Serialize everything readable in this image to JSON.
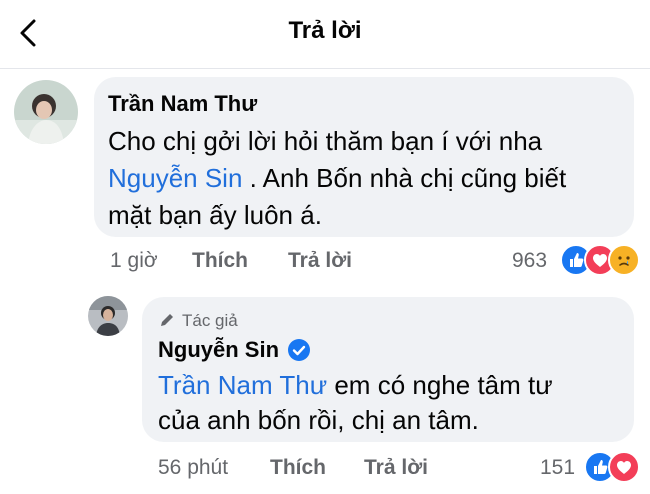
{
  "header": {
    "title": "Trả lời"
  },
  "comment": {
    "author": "Trần Nam Thư",
    "line1": "Cho chị gởi lời hỏi thăm bạn í với nha",
    "mention": "Nguyễn Sin",
    "line2_rest": " . Anh Bốn nhà chị cũng biết",
    "line3": "mặt bạn ấy luôn á.",
    "time": "1 giờ",
    "like_label": "Thích",
    "reply_label": "Trả lời",
    "reaction_count": "963",
    "reactions": [
      "like-icon",
      "love-icon",
      "care-icon"
    ]
  },
  "reply": {
    "author_tag": "Tác giả",
    "author": "Nguyễn Sin",
    "verified": true,
    "mention": "Trần Nam Thư",
    "line1_rest": " em có nghe tâm tư",
    "line2": "của anh bốn rồi, chị an tâm.",
    "time": "56 phút",
    "like_label": "Thích",
    "reply_label": "Trả lời",
    "reaction_count": "151",
    "reactions": [
      "like-icon",
      "love-icon"
    ]
  },
  "colors": {
    "mention": "#216fdb",
    "bubble": "#f0f2f5",
    "meta": "#65676b",
    "like": "#1877f2",
    "love": "#f33e58",
    "care": "#f7b125"
  }
}
